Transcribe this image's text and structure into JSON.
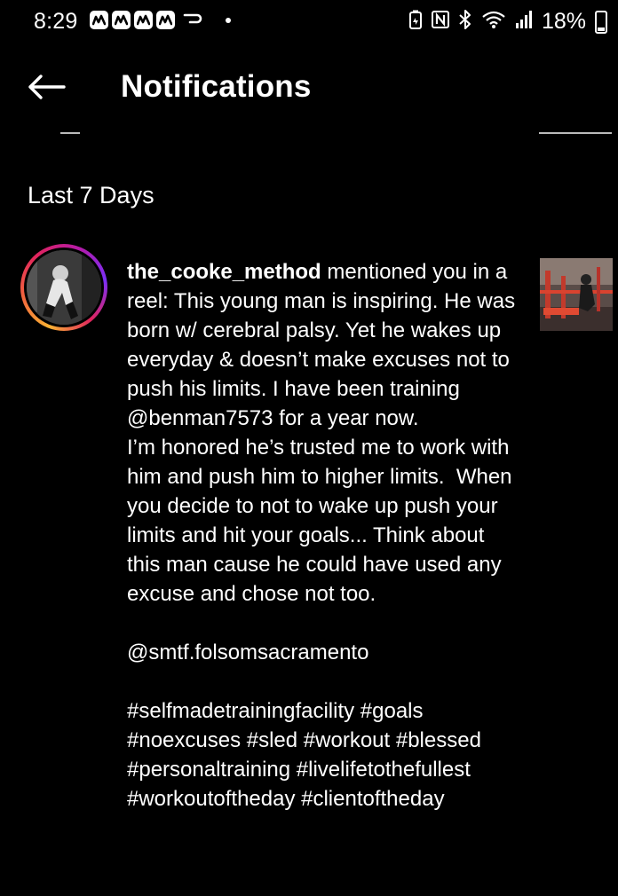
{
  "status_bar": {
    "time": "8:29",
    "battery_percent": "18%",
    "notification_icons": [
      "news-icon",
      "news-icon",
      "news-icon",
      "news-icon",
      "cast-icon",
      "dot-icon"
    ],
    "system_icons": [
      "battery-saver-icon",
      "nfc-icon",
      "bluetooth-icon",
      "wifi-icon",
      "signal-icon",
      "battery-icon"
    ]
  },
  "header": {
    "back_icon": "arrow-left-icon",
    "title": "Notifications"
  },
  "section": {
    "heading": "Last 7 Days"
  },
  "notification": {
    "username": "the_cooke_method",
    "message": " mentioned you in a reel: This young man is inspiring. He was born w/ cerebral palsy. Yet he wakes up everyday & doesn’t make excuses not to push his limits. I have been training @benman7573 for a year now.\nI’m honored he’s trusted me to work with him and push him to higher limits.  When you decide to not to wake up push your limits and hit your goals... Think about this man cause he could have used any excuse and chose not too.\n\n@smtf.folsomsacramento\n\n#selfmadetrainingfacility #goals #noexcuses #sled #workout #blessed #personaltraining #livelifetothefullest #workoutoftheday #clientoftheday",
    "avatar_ring_colors": [
      "#f9b233",
      "#f2613f",
      "#e0245e",
      "#b51aa6"
    ],
    "thumbnail_accent": "#d9432f"
  },
  "colors": {
    "background": "#000000",
    "text": "#ffffff"
  }
}
